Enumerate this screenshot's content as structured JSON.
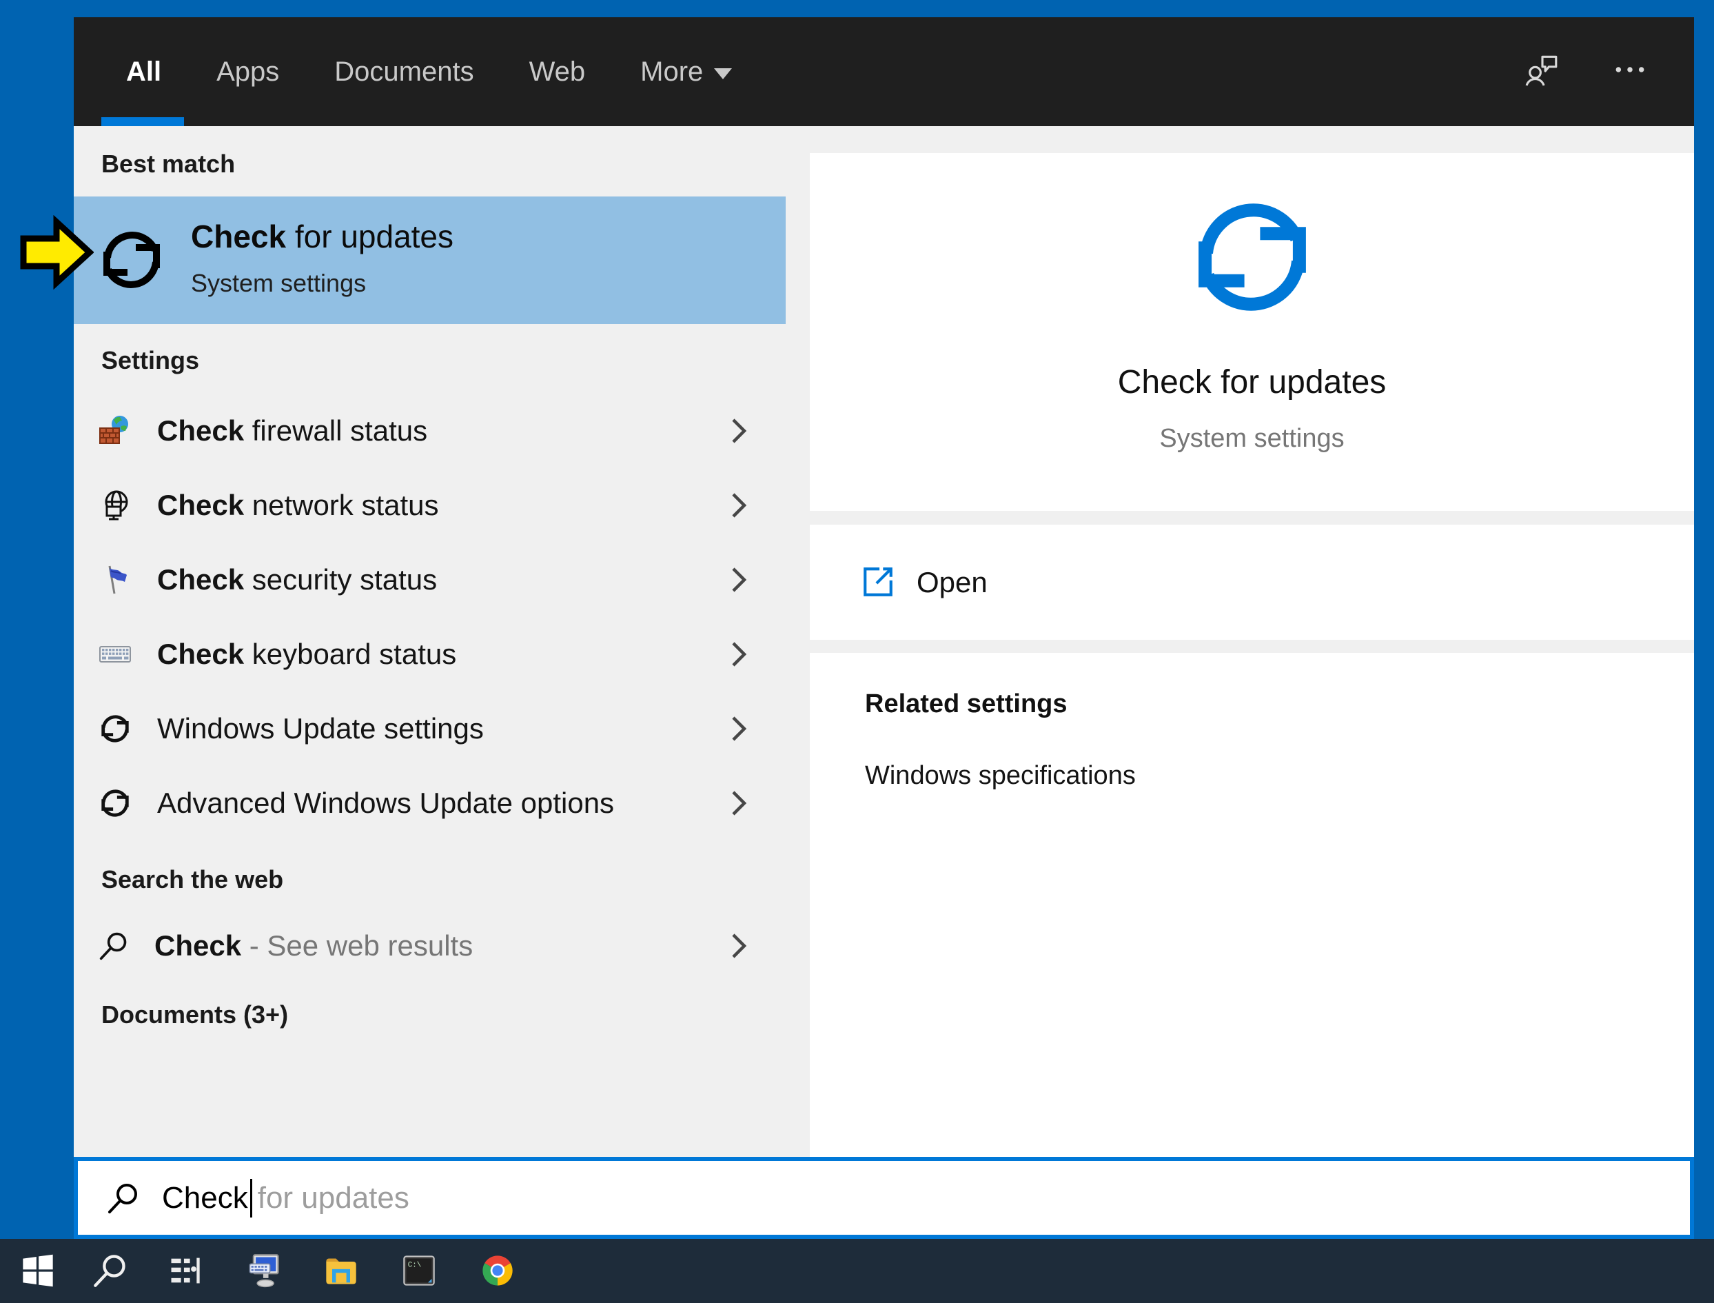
{
  "search_window": {
    "tabs": [
      {
        "label": "All",
        "active": true
      },
      {
        "label": "Apps",
        "active": false
      },
      {
        "label": "Documents",
        "active": false
      },
      {
        "label": "Web",
        "active": false
      },
      {
        "label": "More",
        "active": false,
        "has_dropdown": true
      }
    ]
  },
  "results_panel": {
    "best_match_heading": "Best match",
    "best_match": {
      "title_query": "Check",
      "title_rest": " for updates",
      "subtitle": "System settings",
      "icon": "sync-icon"
    },
    "settings_heading": "Settings",
    "settings_items": [
      {
        "query": "Check",
        "rest": " firewall status",
        "icon": "firewall-icon"
      },
      {
        "query": "Check",
        "rest": " network status",
        "icon": "network-globe-icon"
      },
      {
        "query": "Check",
        "rest": " security status",
        "icon": "security-flag-icon"
      },
      {
        "query": "Check",
        "rest": " keyboard status",
        "icon": "keyboard-icon"
      },
      {
        "query": "",
        "rest": "Windows Update settings",
        "icon": "sync-icon"
      },
      {
        "query": "",
        "rest": "Advanced Windows Update options",
        "icon": "sync-icon"
      }
    ],
    "web_heading": "Search the web",
    "web_item": {
      "query": "Check",
      "rest": " - See web results",
      "icon": "search-icon"
    },
    "documents_heading": "Documents (3+)"
  },
  "preview_panel": {
    "title": "Check for updates",
    "subtitle": "System settings",
    "open_label": "Open",
    "related_heading": "Related settings",
    "related_items": [
      "Windows specifications"
    ]
  },
  "search_box": {
    "typed_text": "Check",
    "suggestion_text": "for updates"
  },
  "taskbar_items": [
    "start",
    "search",
    "task-view",
    "remote-desktop",
    "file-explorer",
    "command-prompt",
    "chrome"
  ],
  "colors": {
    "desktop_blue": "#0063b1",
    "accent_blue": "#0078d7",
    "highlight_blue": "#91bfe3",
    "header_dark": "#1f1f1f",
    "panel_gray": "#f0f0f0",
    "taskbar_dark": "#1e2c3a",
    "arrow_yellow": "#ffeb00"
  }
}
